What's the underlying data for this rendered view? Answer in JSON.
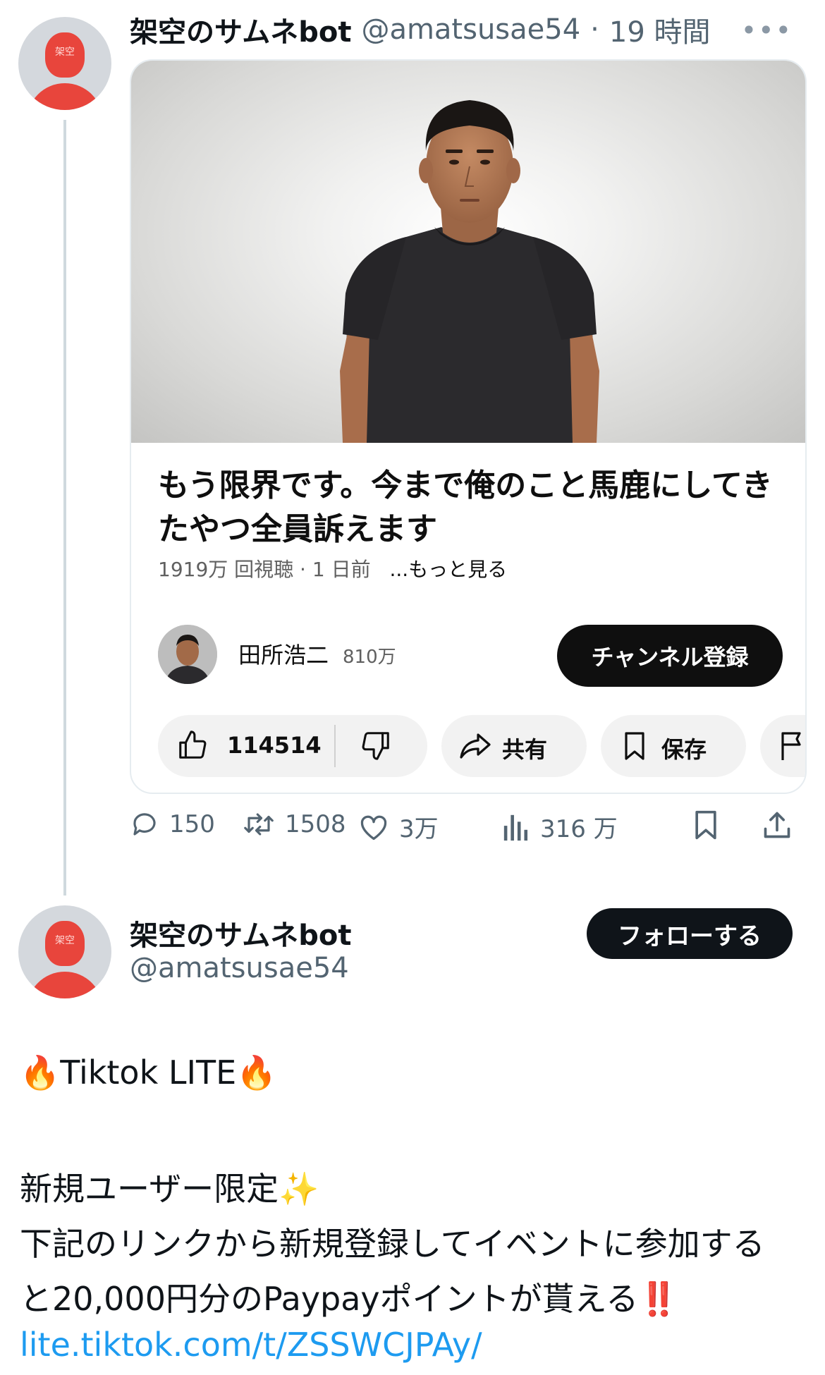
{
  "tweet1": {
    "author_name": "架空のサムネbot",
    "handle": "@amatsusae54",
    "separator": "·",
    "time": "19 時間",
    "avatar_label": "架空",
    "more_icon": "•••",
    "card": {
      "video_title": "もう限界です。今まで俺のこと馬鹿にしてきたやつ全員訴えます",
      "meta": "1919万 回視聴 · 1 日前",
      "more_label": "...もっと見る",
      "channel_name": "田所浩二",
      "channel_subs": "810万",
      "subscribe_label": "チャンネル登録",
      "like_count": "114514",
      "share_label": "共有",
      "save_label": "保存"
    },
    "actions": {
      "replies": "150",
      "retweets": "1508",
      "likes": "3万",
      "views": "316 万"
    }
  },
  "tweet2": {
    "author_name": "架空のサムネbot",
    "handle": "@amatsusae54",
    "avatar_label": "架空",
    "follow_label": "フォローする",
    "line1_emoji_a": "🔥",
    "line1_text": "Tiktok LITE",
    "line1_emoji_b": "🔥",
    "line2_text": "新規ユーザー限定",
    "line2_emoji": "✨",
    "line3_text": "下記のリンクから新規登録してイベントに参加する",
    "line4_text": "と20,000円分のPaypayポイントが貰える",
    "line4_emoji": "‼️",
    "link": "lite.tiktok.com/t/ZSSWCJPAy/"
  }
}
